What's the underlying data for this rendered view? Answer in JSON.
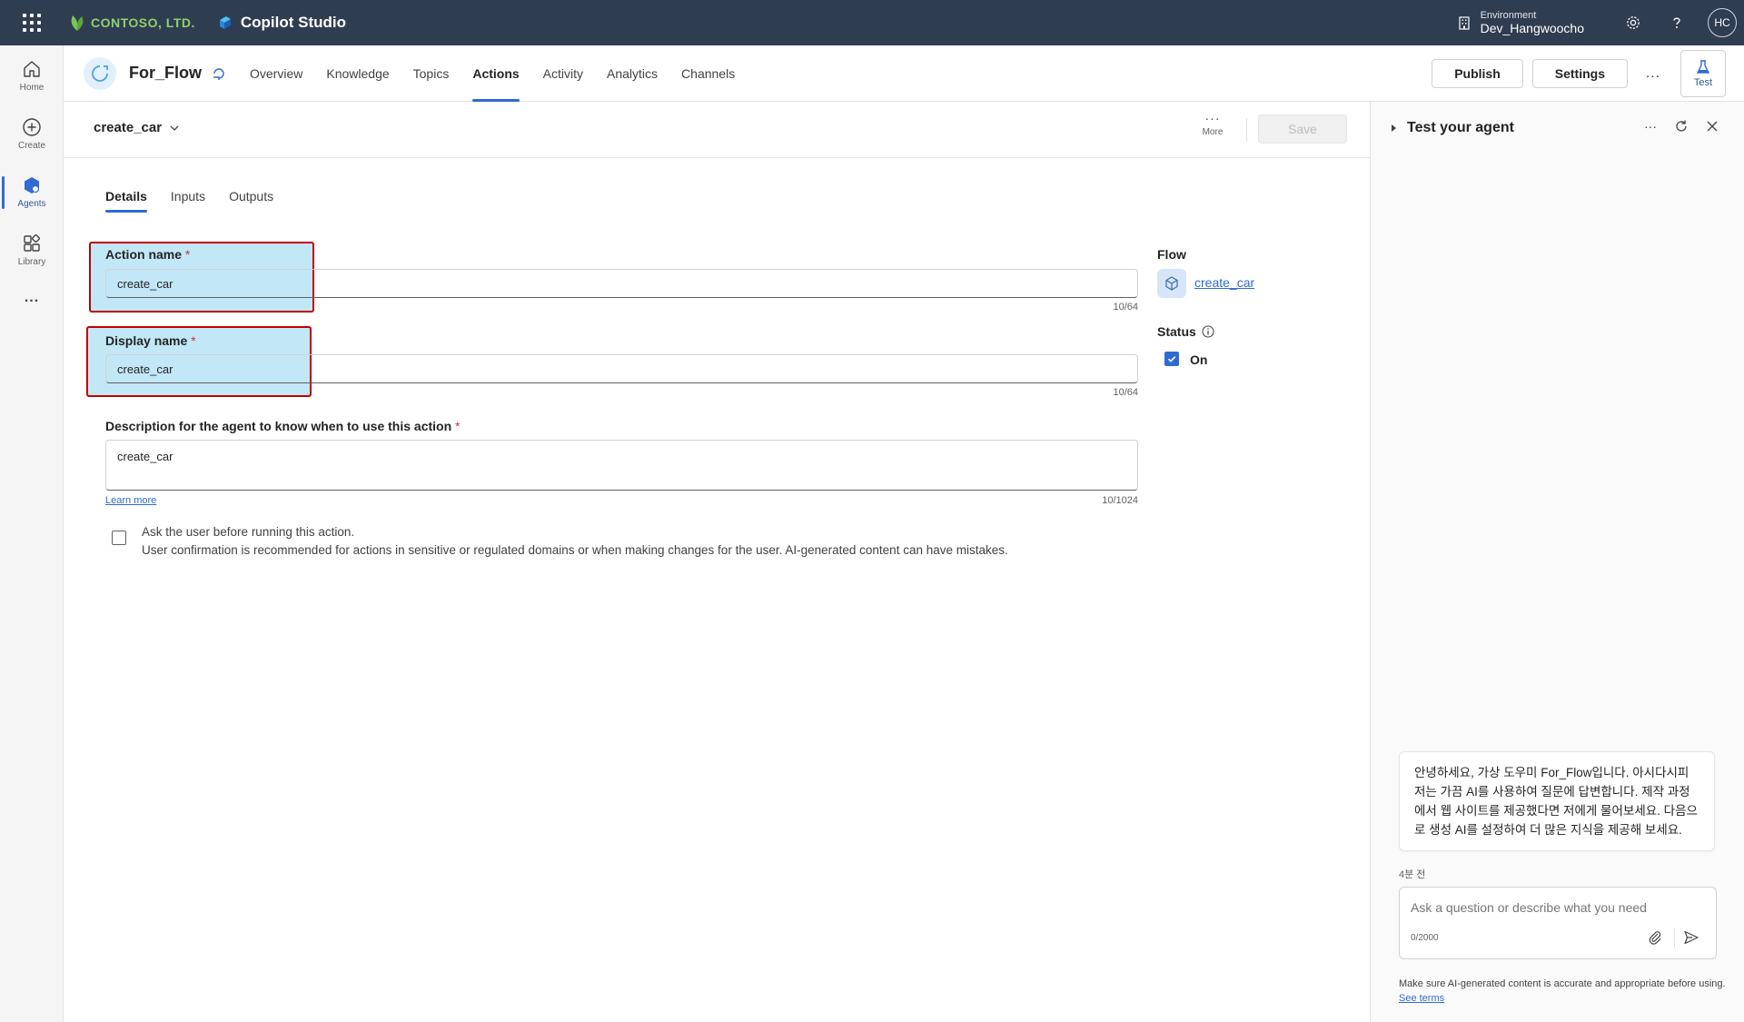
{
  "topbar": {
    "org_name": "CONTOSO, LTD.",
    "product_name": "Copilot Studio",
    "environment_label": "Environment",
    "environment_name": "Dev_Hangwoocho",
    "user_initials": "HC"
  },
  "rail": {
    "items": [
      {
        "label": "Home",
        "icon": "home-icon"
      },
      {
        "label": "Create",
        "icon": "plus-circle-icon"
      },
      {
        "label": "Agents",
        "icon": "agents-icon",
        "active": true
      },
      {
        "label": "Library",
        "icon": "library-icon"
      }
    ],
    "more": "..."
  },
  "header": {
    "agent_name": "For_Flow",
    "tabs": [
      "Overview",
      "Knowledge",
      "Topics",
      "Actions",
      "Activity",
      "Analytics",
      "Channels"
    ],
    "active_tab": "Actions",
    "publish_label": "Publish",
    "settings_label": "Settings",
    "more": "...",
    "test_label": "Test"
  },
  "action": {
    "title": "create_car",
    "more_label": "More",
    "save_label": "Save",
    "subtabs": [
      "Details",
      "Inputs",
      "Outputs"
    ],
    "active_subtab": "Details",
    "action_name_label": "Action name",
    "action_name_value": "create_car",
    "action_name_counter": "10/64",
    "display_name_label": "Display name",
    "display_name_value": "create_car",
    "display_name_counter": "10/64",
    "required_marker": "*",
    "description_label": "Description for the agent to know when to use this action",
    "description_value": "create_car",
    "description_counter": "10/1024",
    "learn_more": "Learn more",
    "confirm_title": "Ask the user before running this action.",
    "confirm_desc": "User confirmation is recommended for actions in sensitive or regulated domains or when making changes for the user. AI-generated content can have mistakes.",
    "confirm_checked": false,
    "flow_label": "Flow",
    "flow_link": "create_car",
    "status_label": "Status",
    "status_value": "On",
    "status_checked": true
  },
  "test_panel": {
    "title": "Test your agent",
    "bot_message": "안녕하세요, 가상 도우미 For_Flow입니다. 아시다시피 저는 가끔 AI를 사용하여 질문에 답변합니다. 제작 과정에서 웹 사이트를 제공했다면 저에게 물어보세요. 다음으로 생성 AI를 설정하여 더 많은 지식을 제공해 보세요.",
    "timestamp": "4분 전",
    "input_placeholder": "Ask a question or describe what you need",
    "char_count": "0/2000",
    "disclaimer": "Make sure AI-generated content is accurate and appropriate before using.",
    "see_terms": "See terms"
  },
  "colors": {
    "topbar_bg": "#2f3d51",
    "accent": "#2f6bd1",
    "highlight_fill": "#ade0f4",
    "highlight_border": "#c00000",
    "required": "#c4314b"
  }
}
